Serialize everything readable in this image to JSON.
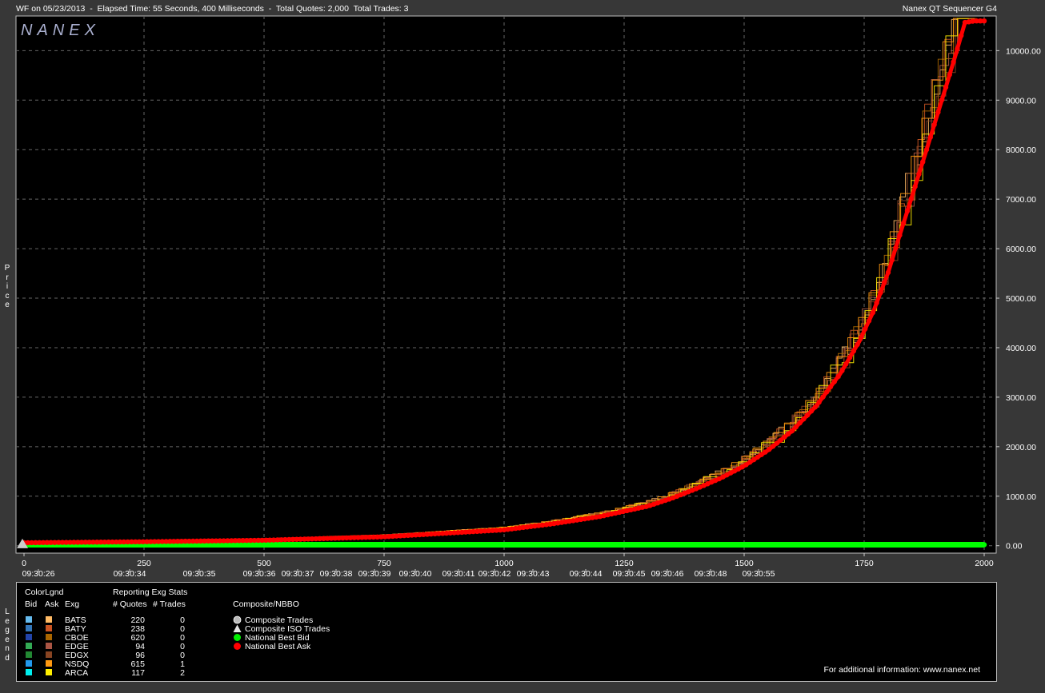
{
  "header": {
    "title": "WF on 05/23/2013  -  Elapsed Time: 55 Seconds, 400 Milliseconds  -  Total Quotes: 2,000  Total Trades: 3",
    "app": "Nanex QT Sequencer G4"
  },
  "logo_text": "NANEX",
  "axis_side_label": "Price",
  "legend_side_label": "Legend",
  "legend": {
    "color_legend_label": "ColorLgnd",
    "reporting_label": "Reporting Exg Stats",
    "col_bid": "Bid",
    "col_ask": "Ask",
    "col_exg": "Exg",
    "col_quotes": "# Quotes",
    "col_trades": "# Trades",
    "composite_title": "Composite/NBBO",
    "exchanges": [
      {
        "name": "BATS",
        "quotes": "220",
        "trades": "0",
        "bid_color": "#66bbee",
        "ask_color": "#ffbb66"
      },
      {
        "name": "BATY",
        "quotes": "238",
        "trades": "0",
        "bid_color": "#3377bb",
        "ask_color": "#cc5522"
      },
      {
        "name": "CBOE",
        "quotes": "620",
        "trades": "0",
        "bid_color": "#2244aa",
        "ask_color": "#aa6600"
      },
      {
        "name": "EDGE",
        "quotes": "94",
        "trades": "0",
        "bid_color": "#33aa55",
        "ask_color": "#aa5544"
      },
      {
        "name": "EDGX",
        "quotes": "96",
        "trades": "0",
        "bid_color": "#228833",
        "ask_color": "#884422"
      },
      {
        "name": "NSDQ",
        "quotes": "615",
        "trades": "1",
        "bid_color": "#2299ee",
        "ask_color": "#ff9911"
      },
      {
        "name": "ARCA",
        "quotes": "117",
        "trades": "2",
        "bid_color": "#00eeee",
        "ask_color": "#ffee00"
      }
    ],
    "composite": [
      {
        "label": "Composite Trades",
        "icon": "gray-circle"
      },
      {
        "label": "Composite ISO Trades",
        "icon": "white-triangle"
      },
      {
        "label": "National Best Bid",
        "icon": "green-circle"
      },
      {
        "label": "National Best Ask",
        "icon": "red-circle"
      }
    ],
    "info": "For additional information: www.nanex.net"
  },
  "chart_data": {
    "type": "line",
    "title": "",
    "xlabel": "",
    "ylabel": "Price",
    "xlim": [
      0,
      2000
    ],
    "ylim": [
      -150,
      10700
    ],
    "grid": true,
    "x_ticks": [
      "0",
      "250",
      "500",
      "750",
      "1000",
      "1250",
      "1500",
      "1750",
      "2000"
    ],
    "y_ticks": [
      "0.00",
      "1000.00",
      "2000.00",
      "3000.00",
      "4000.00",
      "5000.00",
      "6000.00",
      "7000.00",
      "8000.00",
      "9000.00",
      "10000.00"
    ],
    "time_ticks": [
      {
        "x": 30,
        "label": "09:30:26"
      },
      {
        "x": 220,
        "label": "09:30:34"
      },
      {
        "x": 365,
        "label": "09:30:35"
      },
      {
        "x": 490,
        "label": "09:30:36"
      },
      {
        "x": 570,
        "label": "09:30:37"
      },
      {
        "x": 650,
        "label": "09:30:38"
      },
      {
        "x": 730,
        "label": "09:30:39"
      },
      {
        "x": 815,
        "label": "09:30:40"
      },
      {
        "x": 905,
        "label": "09:30:41"
      },
      {
        "x": 980,
        "label": "09:30:42"
      },
      {
        "x": 1060,
        "label": "09:30:43"
      },
      {
        "x": 1170,
        "label": "09:30:44"
      },
      {
        "x": 1260,
        "label": "09:30:45"
      },
      {
        "x": 1340,
        "label": "09:30:46"
      },
      {
        "x": 1430,
        "label": "09:30:48"
      },
      {
        "x": 1530,
        "label": "09:30:55"
      }
    ],
    "series": [
      {
        "name": "National Best Ask",
        "color": "#ff0000",
        "x": [
          0,
          250,
          500,
          750,
          1000,
          1100,
          1200,
          1300,
          1350,
          1400,
          1450,
          1500,
          1550,
          1600,
          1650,
          1700,
          1740,
          1770,
          1800,
          1820,
          1840,
          1860,
          1880,
          1900,
          1920,
          1940,
          1960,
          1980,
          2000
        ],
        "y": [
          60,
          80,
          110,
          180,
          320,
          440,
          590,
          800,
          960,
          1150,
          1360,
          1610,
          1930,
          2320,
          2820,
          3470,
          4130,
          4750,
          5520,
          6150,
          6760,
          7380,
          8000,
          8630,
          9260,
          9900,
          10570,
          10600,
          10600
        ]
      },
      {
        "name": "National Best Bid",
        "color": "#00ff00",
        "x": [
          0,
          2000
        ],
        "y": [
          20,
          20
        ]
      }
    ]
  }
}
